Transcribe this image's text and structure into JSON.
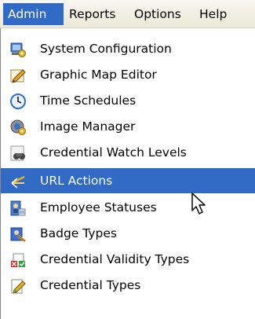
{
  "menubar": {
    "items": [
      {
        "label": "Admin",
        "active": true
      },
      {
        "label": "Reports",
        "active": false
      },
      {
        "label": "Options",
        "active": false
      },
      {
        "label": "Help",
        "active": false
      }
    ]
  },
  "dropdown": {
    "items": [
      {
        "label": "System Configuration",
        "icon": "system-config-icon"
      },
      {
        "label": "Graphic Map Editor",
        "icon": "map-editor-icon"
      },
      {
        "label": "Time Schedules",
        "icon": "clock-icon"
      },
      {
        "label": "Image Manager",
        "icon": "image-manager-icon"
      },
      {
        "label": "Credential Watch Levels",
        "icon": "binoculars-icon"
      },
      {
        "label": "URL Actions",
        "icon": "url-action-icon",
        "highlighted": true
      },
      {
        "label": "Employee Statuses",
        "icon": "employee-status-icon"
      },
      {
        "label": "Badge Types",
        "icon": "badge-icon"
      },
      {
        "label": "Credential Validity Types",
        "icon": "credential-validity-icon"
      },
      {
        "label": "Credential Types",
        "icon": "credential-types-icon"
      }
    ]
  },
  "colors": {
    "highlight": "#316ac5",
    "menubar_bg": "#ece9d8"
  }
}
